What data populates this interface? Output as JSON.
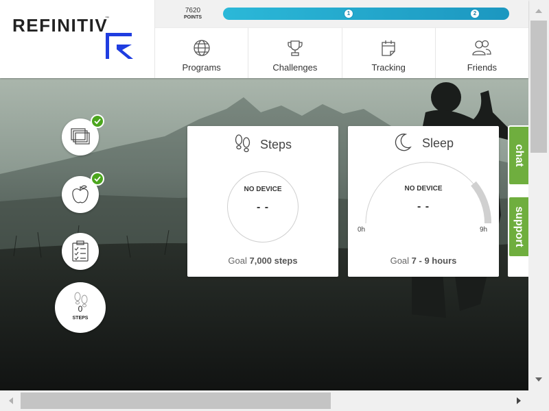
{
  "brand": {
    "name": "REFINITIV",
    "trademark": "™",
    "accent_color": "#1f3de0"
  },
  "points": {
    "value": "7620",
    "label": "POINTS",
    "milestones": [
      "1",
      "2"
    ],
    "bar_color": "#1c97c0"
  },
  "nav": [
    {
      "label": "Programs",
      "icon": "globe-icon"
    },
    {
      "label": "Challenges",
      "icon": "trophy-icon"
    },
    {
      "label": "Tracking",
      "icon": "calendar-icon"
    },
    {
      "label": "Friends",
      "icon": "people-icon"
    }
  ],
  "side_buttons": [
    {
      "icon": "stacked-cards-icon",
      "completed": true
    },
    {
      "icon": "apple-icon",
      "completed": true
    },
    {
      "icon": "clipboard-checklist-icon",
      "completed": false
    }
  ],
  "steps_widget": {
    "count": "0",
    "label": "STEPS",
    "icon": "footprints-icon"
  },
  "cards": {
    "steps": {
      "title": "Steps",
      "icon": "footprints-icon",
      "status": "NO DEVICE",
      "value": "- -",
      "goal_prefix": "Goal",
      "goal_value": "7,000 steps"
    },
    "sleep": {
      "title": "Sleep",
      "icon": "moon-icon",
      "status": "NO DEVICE",
      "value": "- -",
      "gauge_min": "0h",
      "gauge_max": "9h",
      "goal_prefix": "Goal",
      "goal_value": "7 - 9 hours"
    }
  },
  "side_tabs": {
    "chat": "chat",
    "support": "support",
    "color": "#6fae3e"
  }
}
